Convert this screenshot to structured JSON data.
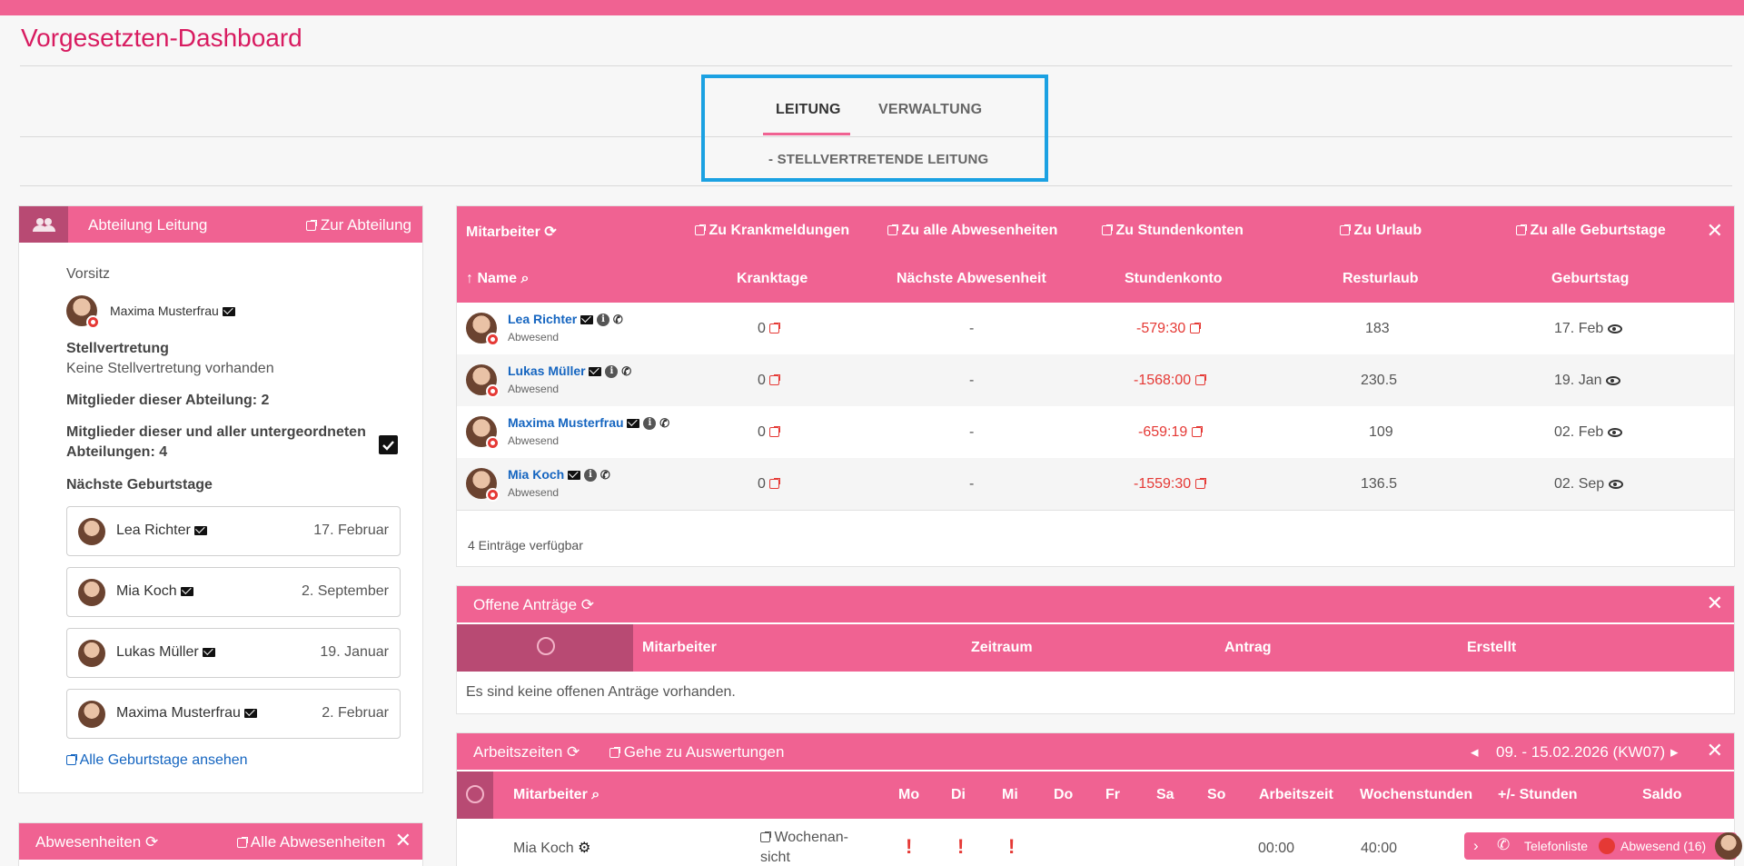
{
  "page": {
    "title": "Vorgesetzten-Dashboard"
  },
  "tabs": {
    "leitung": "LEITUNG",
    "verwaltung": "VERWALTUNG",
    "stellvertretende": "- STELLVERTRETENDE LEITUNG"
  },
  "abteilung": {
    "title": "Abteilung Leitung",
    "link": "Zur Abteilung",
    "vorsitz_label": "Vorsitz",
    "vorsitz_name": "Maxima Musterfrau",
    "stellvertretung_label": "Stellvertretung",
    "stellvertretung_value": "Keine Stellvertretung vorhanden",
    "mitglieder": "Mitglieder dieser Abteilung: 2",
    "mitglieder_alle_1": "Mitglieder dieser und aller untergeordneten",
    "mitglieder_alle_2": "Abteilungen: 4",
    "geburtstage_label": "Nächste Geburtstage",
    "geburtstage": [
      {
        "name": "Lea Richter",
        "date": "17. Februar"
      },
      {
        "name": "Mia Koch",
        "date": "2. September"
      },
      {
        "name": "Lukas Müller",
        "date": "19. Januar"
      },
      {
        "name": "Maxima Musterfrau",
        "date": "2. Februar"
      }
    ],
    "alle_geburtstage": "Alle Geburtstage ansehen"
  },
  "abwesenheiten": {
    "title": "Abwesenheiten",
    "link": "Alle Abwesenheiten"
  },
  "mitarbeiter": {
    "title": "Mitarbeiter",
    "links": [
      "Zu Krankmeldungen",
      "Zu alle Abwesenheiten",
      "Zu Stundenkonten",
      "Zu Urlaub",
      "Zu alle Geburtstage"
    ],
    "columns": [
      "Name",
      "Kranktage",
      "Nächste Abwesenheit",
      "Stundenkonto",
      "Resturlaub",
      "Geburtstag"
    ],
    "rows": [
      {
        "name": "Lea Richter",
        "status": "Abwesend",
        "kranktage": "0",
        "abwesenheit": "-",
        "stundenkonto": "-579:30",
        "resturlaub": "183",
        "geburtstag": "17. Feb"
      },
      {
        "name": "Lukas Müller",
        "status": "Abwesend",
        "kranktage": "0",
        "abwesenheit": "-",
        "stundenkonto": "-1568:00",
        "resturlaub": "230.5",
        "geburtstag": "19. Jan"
      },
      {
        "name": "Maxima Musterfrau",
        "status": "Abwesend",
        "kranktage": "0",
        "abwesenheit": "-",
        "stundenkonto": "-659:19",
        "resturlaub": "109",
        "geburtstag": "02. Feb"
      },
      {
        "name": "Mia Koch",
        "status": "Abwesend",
        "kranktage": "0",
        "abwesenheit": "-",
        "stundenkonto": "-1559:30",
        "resturlaub": "136.5",
        "geburtstag": "02. Sep"
      }
    ],
    "footer": "4 Einträge verfügbar"
  },
  "antraege": {
    "title": "Offene Anträge",
    "columns": [
      "Mitarbeiter",
      "Zeitraum",
      "Antrag",
      "Erstellt"
    ],
    "empty": "Es sind keine offenen Anträge vorhanden."
  },
  "arbeitszeiten": {
    "title": "Arbeitszeiten",
    "link": "Gehe zu Auswertungen",
    "week": "09. - 15.02.2026 (KW07)",
    "columns": [
      "Mitarbeiter",
      "Mo",
      "Di",
      "Mi",
      "Do",
      "Fr",
      "Sa",
      "So",
      "Arbeitszeit",
      "Wochenstunden",
      "+/- Stunden",
      "Saldo"
    ],
    "row": {
      "name": "Mia Koch",
      "link1": "Wochenan-",
      "link2": "sicht",
      "arbeitszeit": "00:00",
      "wochenstunden": "40:00"
    }
  },
  "bottom": {
    "telefonliste": "Telefonliste",
    "abwesend": "Abwesend (16)"
  },
  "colors": {
    "accent": "#f06292",
    "title": "#d81b60",
    "highlight": "#1ba1e2",
    "negative": "#e53935"
  }
}
